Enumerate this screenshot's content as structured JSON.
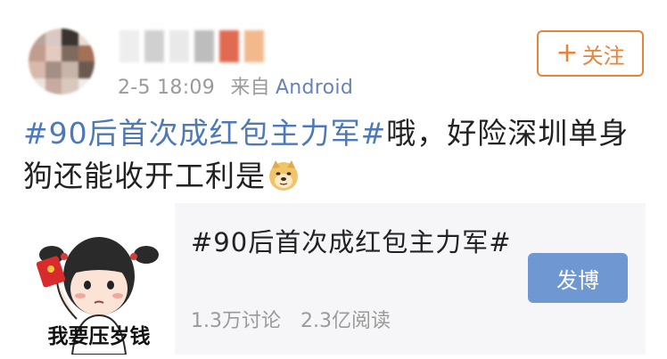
{
  "post": {
    "timestamp": "2-5 18:09",
    "via": "来自",
    "source": "Android",
    "follow_label": "关注",
    "follow_plus": "+",
    "text_hashtag": "#90后首次成红包主力军#",
    "text_body": "哦，好险深圳单身狗还能收开工利是",
    "emoji": "doge-emoji"
  },
  "topic_card": {
    "thumb_caption": "我要压岁钱",
    "title": "#90后首次成红包主力军#",
    "discussions": "1.3万讨论",
    "reads": "2.3亿阅读",
    "post_button": "发博"
  },
  "colors": {
    "link": "#4d79b8",
    "source": "#6683b8",
    "follow": "#e8843a",
    "post_button": "#6f98d2",
    "muted": "#9a9a9a"
  }
}
